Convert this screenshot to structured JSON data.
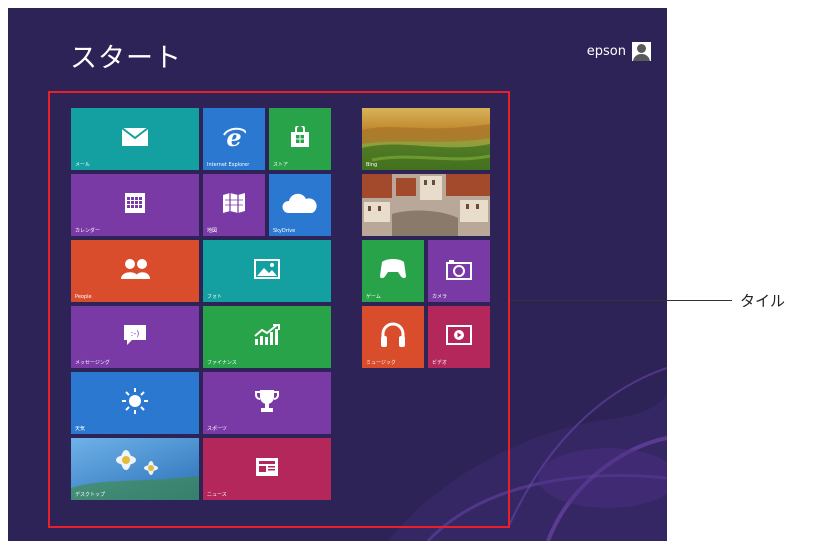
{
  "start": {
    "title": "スタート",
    "username": "epson"
  },
  "tiles": {
    "mail": "メール",
    "ie": "Internet Explorer",
    "store": "ストア",
    "bing": "Bing",
    "calendar": "カレンダー",
    "maps": "地図",
    "skydrive": "SkyDrive",
    "people": "People",
    "photos": "フォト",
    "games": "ゲーム",
    "camera": "カメラ",
    "messaging": "メッセージング",
    "finance": "ファイナンス",
    "music": "ミュージック",
    "video": "ビデオ",
    "weather": "天気",
    "sports": "スポーツ",
    "desktop": "デスクトップ",
    "news": "ニュース"
  },
  "annotation": {
    "label": "タイル"
  },
  "colors": {
    "background": "#2e2356",
    "teal": "#14a0a0",
    "blue": "#2a78d0",
    "green": "#29a34a",
    "purple": "#7a3aa5",
    "orange": "#d94c2c",
    "magenta": "#b3275b",
    "highlight": "#e8202a"
  },
  "icons": [
    "envelope-icon",
    "ie-icon",
    "store-bag-icon",
    "calendar-icon",
    "map-icon",
    "cloud-icon",
    "people-icon",
    "picture-icon",
    "gamepad-icon",
    "camera-icon",
    "speech-bubble-icon",
    "chart-icon",
    "headphones-icon",
    "play-icon",
    "sun-icon",
    "trophy-icon",
    "newspaper-icon",
    "user-avatar-icon"
  ]
}
